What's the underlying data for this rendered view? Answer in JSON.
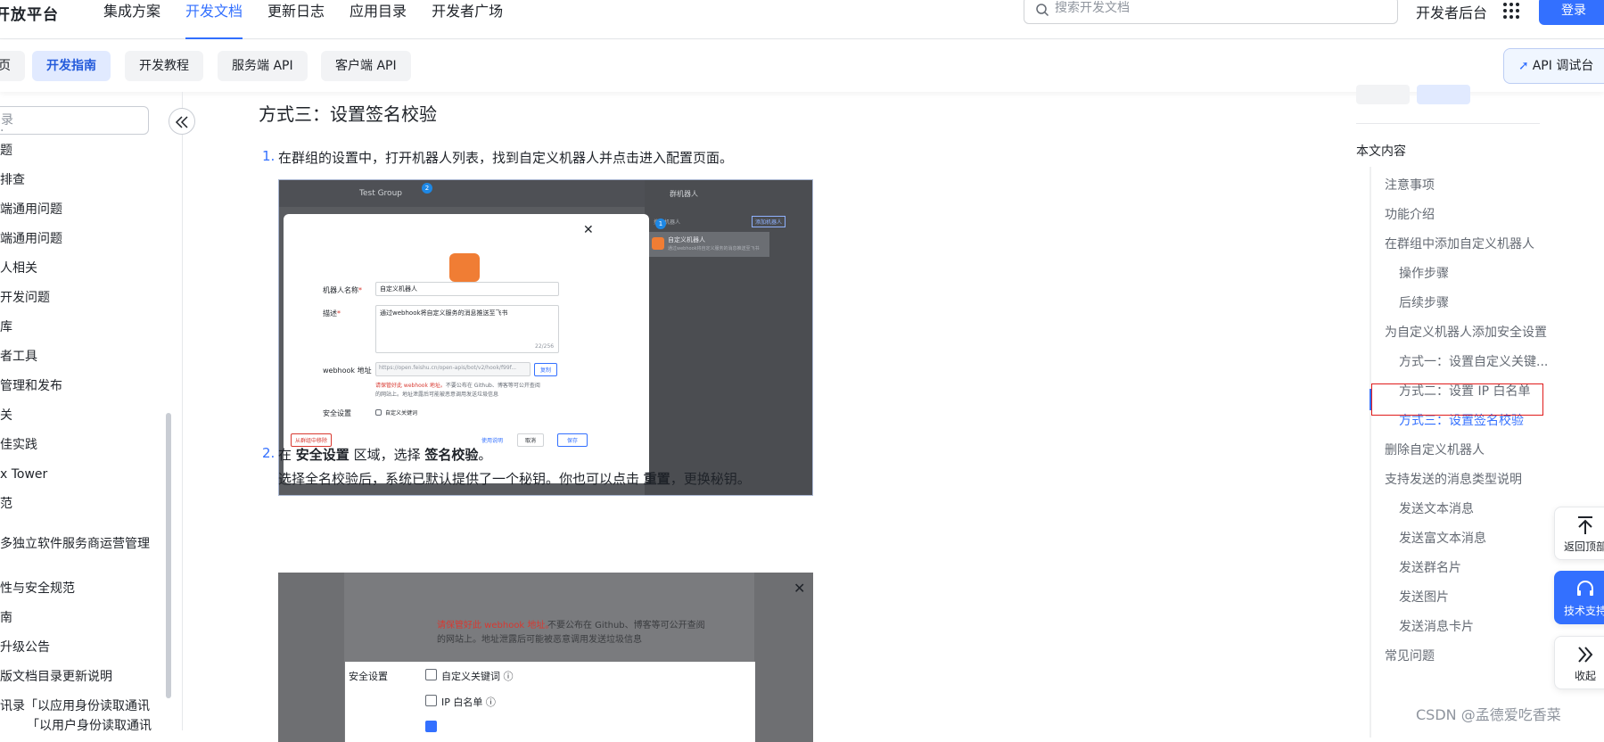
{
  "header": {
    "brand": "开放平台",
    "nav": [
      "集成方案",
      "开发文档",
      "更新日志",
      "应用目录",
      "开发者广场"
    ],
    "active_nav": "开发文档",
    "search_placeholder": "搜索开发文档",
    "dev_console": "开发者后台",
    "login": "登录"
  },
  "subnav": {
    "tabs": [
      "页",
      "开发指南",
      "开发教程",
      "服务端 API",
      "客户端 API"
    ],
    "active": "开发指南",
    "api_debug": "API 调试台"
  },
  "sidebar": {
    "search_placeholder": "录",
    "items": [
      "题",
      "排查",
      "端通用问题",
      "端通用问题",
      "人相关",
      "开发问题",
      "库",
      "者工具",
      "管理和发布",
      "关",
      "佳实践",
      "x Tower",
      "范",
      "多独立软件服务商运营管理",
      "",
      "性与安全规范",
      "南",
      "升级公告",
      "版文档目录更新说明",
      "讯录「以应用身份读取通讯",
      "「以用户身份读取通讯"
    ]
  },
  "article": {
    "heading": "方式三：设置签名校验",
    "step1_num": "1.",
    "step1_text": "在群组的设置中，打开机器人列表，找到自定义机器人并点击进入配置页面。",
    "step2_num": "2.",
    "step2_prefix": "在 ",
    "step2_bold1": "安全设置",
    "step2_mid": " 区域，选择 ",
    "step2_bold2": "签名校验",
    "step2_suffix": "。",
    "step2_line2_prefix": "选择全名校验后，系统已默认提供了一个秘钥。你也可以点击 ",
    "step2_line2_bold": "重置",
    "step2_line2_suffix": "，更换秘钥。"
  },
  "screenshot1": {
    "group_name": "Test Group",
    "panel_title": "群机器人",
    "panel_search": "搜索机器人",
    "panel_add": "添加机器人",
    "robot_name": "自定义机器人",
    "robot_desc": "通过webhook将自定义服务的消息推送至飞书",
    "label_name": "机器人名称",
    "value_name": "自定义机器人",
    "label_desc": "描述",
    "value_desc": "通过webhook将自定义服务的消息推送至飞书",
    "desc_count": "22/256",
    "label_webhook": "webhook 地址",
    "value_webhook": "https://open.feishu.cn/open-apis/bot/v2/hook/f99f...",
    "copy": "复制",
    "warning_red": "请保管好此 webhook 地址。",
    "warning_rest": "不要公布在 Github、博客等可公开查阅",
    "warning_line2": "的网站上。地址泄露后可能被恶意调用发送垃圾信息",
    "label_security": "安全设置",
    "option_keyword": "自定义关键词",
    "remove": "从群组中移除",
    "guide": "使用说明",
    "cancel": "取消",
    "save": "保存",
    "badge1": "1",
    "badge2": "2"
  },
  "screenshot2": {
    "warning_red": "请保管好此 webhook 地址。",
    "warning_rest": "不要公布在 Github、博客等可公开查阅",
    "warning_line2": "的网站上。地址泄露后可能被恶意调用发送垃圾信息",
    "label_security": "安全设置",
    "option_keyword": "自定义关键词",
    "option_ip": "IP 白名单"
  },
  "toc": {
    "title": "本文内容",
    "items": [
      {
        "label": "注意事项",
        "level": 1
      },
      {
        "label": "功能介绍",
        "level": 1
      },
      {
        "label": "在群组中添加自定义机器人",
        "level": 1
      },
      {
        "label": "操作步骤",
        "level": 2
      },
      {
        "label": "后续步骤",
        "level": 2
      },
      {
        "label": "为自定义机器人添加安全设置",
        "level": 1
      },
      {
        "label": "方式一：设置自定义关键...",
        "level": 2
      },
      {
        "label": "方式二：设置 IP 白名单",
        "level": 2
      },
      {
        "label": "方式三：设置签名校验",
        "level": 2,
        "active": true
      },
      {
        "label": "删除自定义机器人",
        "level": 1
      },
      {
        "label": "支持发送的消息类型说明",
        "level": 1
      },
      {
        "label": "发送文本消息",
        "level": 2
      },
      {
        "label": "发送富文本消息",
        "level": 2
      },
      {
        "label": "发送群名片",
        "level": 2
      },
      {
        "label": "发送图片",
        "level": 2
      },
      {
        "label": "发送消息卡片",
        "level": 2
      },
      {
        "label": "常见问题",
        "level": 1
      }
    ]
  },
  "float": {
    "back_top": "返回顶部",
    "support": "技术支持",
    "collapse": "收起"
  },
  "watermark": "CSDN @孟德爱吃香菜",
  "colors": {
    "accent": "#3370ff",
    "highlight_border": "#e01b1b"
  }
}
